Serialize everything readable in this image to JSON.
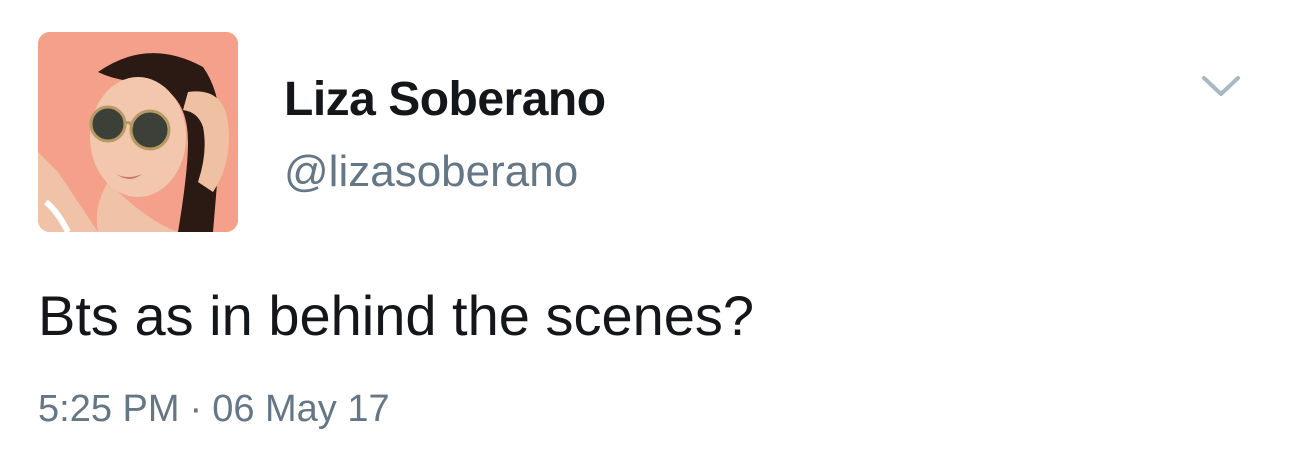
{
  "tweet": {
    "author": {
      "display_name": "Liza Soberano",
      "handle": "@lizasoberano"
    },
    "text": "Bts as in behind the scenes?",
    "time": "5:25 PM",
    "separator": "·",
    "date": "06 May 17",
    "menu_icon": "chevron-down-icon",
    "avatar_icon": "profile-photo"
  },
  "colors": {
    "text_primary": "#14171a",
    "text_secondary": "#657786",
    "chevron": "#aab8c2",
    "avatar_background": "#f4a08a"
  }
}
